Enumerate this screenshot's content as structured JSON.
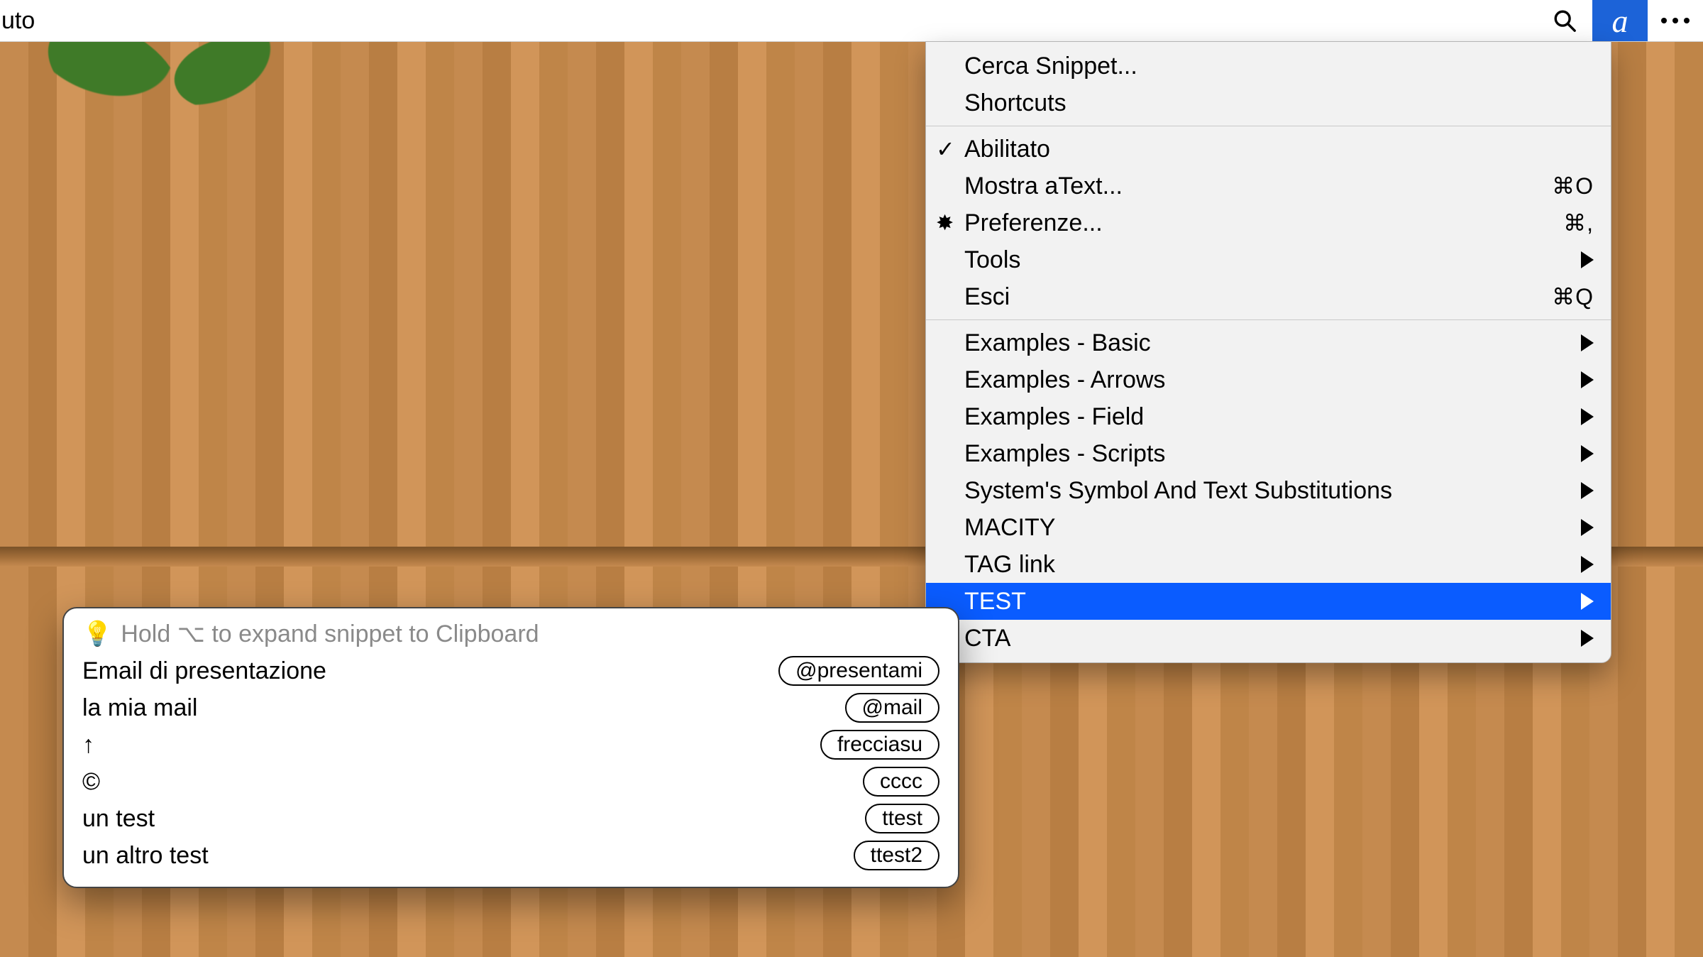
{
  "topbar": {
    "title_fragment": "uto",
    "app_icon_letter": "a"
  },
  "menu": {
    "section1": [
      {
        "label": "Cerca Snippet..."
      },
      {
        "label": "Shortcuts"
      }
    ],
    "section2": [
      {
        "label": "Abilitato",
        "checked": true
      },
      {
        "label": "Mostra aText...",
        "shortcut": "⌘O"
      },
      {
        "label": "Preferenze...",
        "gear": true,
        "shortcut": "⌘,"
      },
      {
        "label": "Tools",
        "submenu": true
      },
      {
        "label": "Esci",
        "shortcut": "⌘Q"
      }
    ],
    "section3": [
      {
        "label": "Examples - Basic",
        "submenu": true
      },
      {
        "label": "Examples - Arrows",
        "submenu": true
      },
      {
        "label": "Examples - Field",
        "submenu": true
      },
      {
        "label": "Examples - Scripts",
        "submenu": true
      },
      {
        "label": "System's Symbol And Text Substitutions",
        "submenu": true
      },
      {
        "label": "MACITY",
        "submenu": true
      },
      {
        "label": "TAG link",
        "submenu": true
      },
      {
        "label": "TEST",
        "submenu": true,
        "selected": true
      },
      {
        "label": "CTA",
        "submenu": true
      }
    ]
  },
  "panel": {
    "hint_icon": "💡",
    "hint_text": "Hold ⌥ to expand snippet to Clipboard",
    "rows": [
      {
        "name": "Email di presentazione",
        "chip": "@presentami"
      },
      {
        "name": "la mia mail",
        "chip": "@mail"
      },
      {
        "name": "↑",
        "chip": "frecciasu"
      },
      {
        "name": "©",
        "chip": "cccc"
      },
      {
        "name": "un test",
        "chip": "ttest"
      },
      {
        "name": "un altro test",
        "chip": "ttest2"
      }
    ]
  },
  "colors": {
    "selection": "#0a5cff",
    "app_icon_bg": "#1c63d8",
    "annotation_arrow": "#f59a1f"
  }
}
